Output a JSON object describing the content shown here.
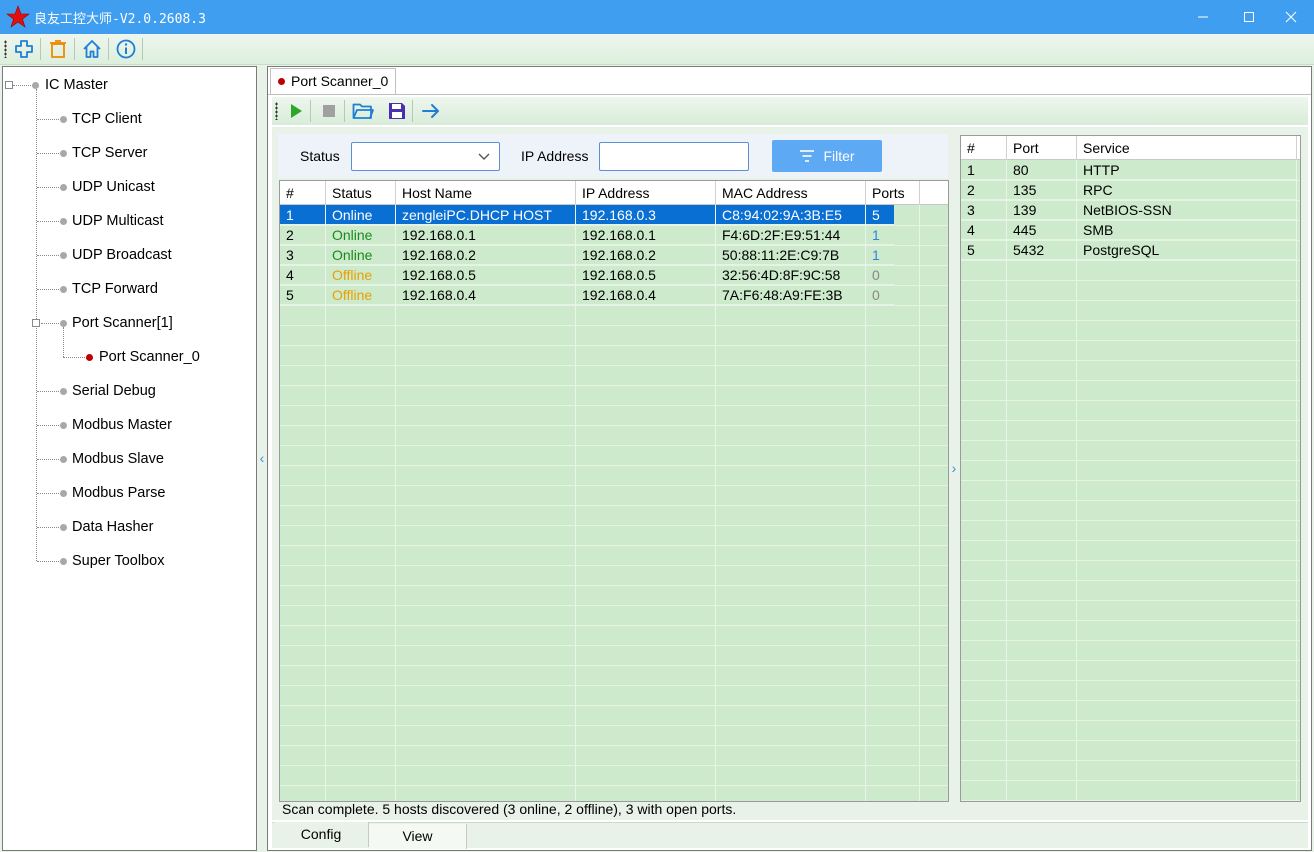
{
  "window": {
    "title": "良友工控大师-V2.0.2608.3",
    "minimize": "minimize",
    "maximize": "maximize",
    "close": "close"
  },
  "toolbar": {
    "buttons": [
      "add-icon",
      "delete-icon",
      "home-icon",
      "info-icon"
    ]
  },
  "tree": {
    "root": "IC Master",
    "items": [
      "TCP Client",
      "TCP Server",
      "UDP Unicast",
      "UDP Multicast",
      "UDP Broadcast",
      "TCP Forward",
      "Port Scanner[1]",
      "Port Scanner_0",
      "Serial Debug",
      "Modbus Master",
      "Modbus Slave",
      "Modbus Parse",
      "Data Hasher",
      "Super Toolbox"
    ]
  },
  "doc_tab": {
    "label": "Port Scanner_0"
  },
  "inner_toolbar": {
    "buttons": [
      "play-icon",
      "stop-icon",
      "open-folder-icon",
      "save-icon",
      "forward-arrow-icon"
    ]
  },
  "filter": {
    "status_label": "Status",
    "status_value": "",
    "ip_label": "IP Address",
    "ip_value": "",
    "button_label": "Filter"
  },
  "hosts": {
    "columns": [
      "#",
      "Status",
      "Host Name",
      "IP Address",
      "MAC Address",
      "Ports"
    ],
    "rows": [
      {
        "n": "1",
        "status": "Online",
        "host": "zengleiPC.DHCP HOST",
        "ip": "192.168.0.3",
        "mac": "C8:94:02:9A:3B:E5",
        "ports": "5"
      },
      {
        "n": "2",
        "status": "Online",
        "host": "192.168.0.1",
        "ip": "192.168.0.1",
        "mac": "F4:6D:2F:E9:51:44",
        "ports": "1"
      },
      {
        "n": "3",
        "status": "Online",
        "host": "192.168.0.2",
        "ip": "192.168.0.2",
        "mac": "50:88:11:2E:C9:7B",
        "ports": "1"
      },
      {
        "n": "4",
        "status": "Offline",
        "host": "192.168.0.5",
        "ip": "192.168.0.5",
        "mac": "32:56:4D:8F:9C:58",
        "ports": "0"
      },
      {
        "n": "5",
        "status": "Offline",
        "host": "192.168.0.4",
        "ip": "192.168.0.4",
        "mac": "7A:F6:48:A9:FE:3B",
        "ports": "0"
      }
    ]
  },
  "ports": {
    "columns": [
      "#",
      "Port",
      "Service"
    ],
    "rows": [
      {
        "n": "1",
        "port": "80",
        "service": "HTTP"
      },
      {
        "n": "2",
        "port": "135",
        "service": "RPC"
      },
      {
        "n": "3",
        "port": "139",
        "service": "NetBIOS-SSN"
      },
      {
        "n": "4",
        "port": "445",
        "service": "SMB"
      },
      {
        "n": "5",
        "port": "5432",
        "service": "PostgreSQL"
      }
    ]
  },
  "status_bar": "Scan complete. 5 hosts discovered (3 online, 2 offline), 3 with open ports.",
  "bottom_tabs": [
    "Config",
    "View"
  ],
  "colors": {
    "online": "#1a8a1a",
    "offline": "#e8a000",
    "ports_blue": "#2e86de",
    "ports_zero": "#888888",
    "selection": "#0a6fd2",
    "grid_bg": "#cdeacd",
    "titlebar": "#3f9ef0"
  }
}
